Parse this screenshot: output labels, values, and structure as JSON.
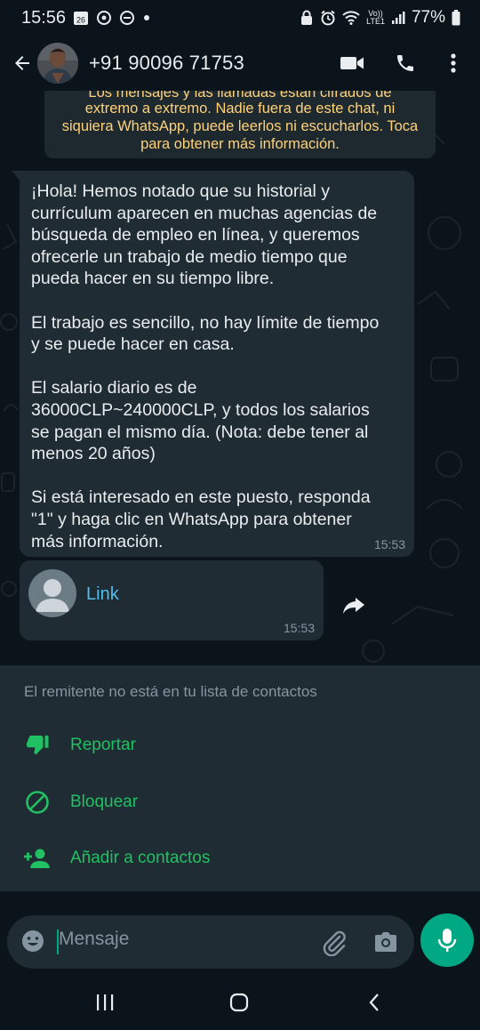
{
  "status_bar": {
    "time": "15:56",
    "calendar_day": "26",
    "network_top": "Vo))",
    "network_bottom": "LTE1",
    "battery": "77%"
  },
  "header": {
    "contact": "+91 90096 71753"
  },
  "encryption_banner": {
    "line0": "Los mensajes y las llamadas están cifrados de",
    "line1": "extremo a extremo. Nadie fuera de este chat, ni",
    "line2": "siquiera WhatsApp, puede leerlos ni escucharlos. Toca",
    "line3": "para obtener más información."
  },
  "messages": [
    {
      "text": "¡Hola! Hemos notado que su historial y\ncurrículum aparecen en muchas agencias de\nbúsqueda de empleo en línea, y queremos\nofrecerle un trabajo de medio tiempo que\npueda hacer en su tiempo libre.\n\nEl trabajo es sencillo, no hay límite de tiempo\ny se puede hacer en casa.\n\nEl salario diario es de\n36000CLP~240000CLP, y todos los salarios\nse pagan el mismo día. (Nota: debe tener al\nmenos 20 años)\n\nSi está interesado en este puesto, responda\n\"1\" y haga clic en WhatsApp para obtener\nmás información.",
      "time": "15:53"
    },
    {
      "label": "Link",
      "time": "15:53"
    }
  ],
  "unknown_contact": {
    "note": "El remitente no está en tu lista de contactos",
    "actions": [
      {
        "label": "Reportar",
        "icon": "thumbs-down-icon"
      },
      {
        "label": "Bloquear",
        "icon": "block-icon"
      },
      {
        "label": "Añadir a contactos",
        "icon": "add-person-icon"
      }
    ]
  },
  "composer": {
    "placeholder": "Mensaje"
  },
  "colors": {
    "background": "#0b141a",
    "bubble": "#202c33",
    "accent": "#00a884",
    "action_text": "#21c063",
    "link": "#53bdeb",
    "banner_text": "#ffd279"
  }
}
